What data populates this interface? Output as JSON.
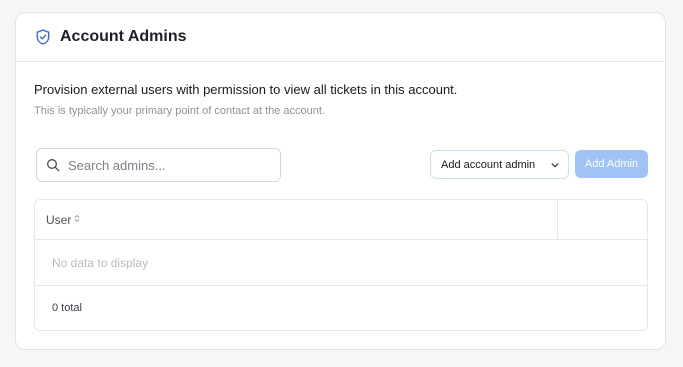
{
  "header": {
    "title": "Account Admins",
    "icon": "shield-check-icon",
    "icon_color": "#3b6fd8"
  },
  "description": {
    "main": "Provision external users with permission to view all tickets in this account.",
    "sub": "This is typically your primary point of contact at the account."
  },
  "search": {
    "placeholder": "Search admins...",
    "value": "",
    "icon": "search-icon"
  },
  "add_select": {
    "label": "Add account admin",
    "icon": "chevron-down-icon"
  },
  "add_button": {
    "label": "Add Admin",
    "color": "#9fc3f5"
  },
  "table": {
    "columns": [
      "User",
      ""
    ],
    "empty_text": "No data to display",
    "total_text": "0 total"
  }
}
